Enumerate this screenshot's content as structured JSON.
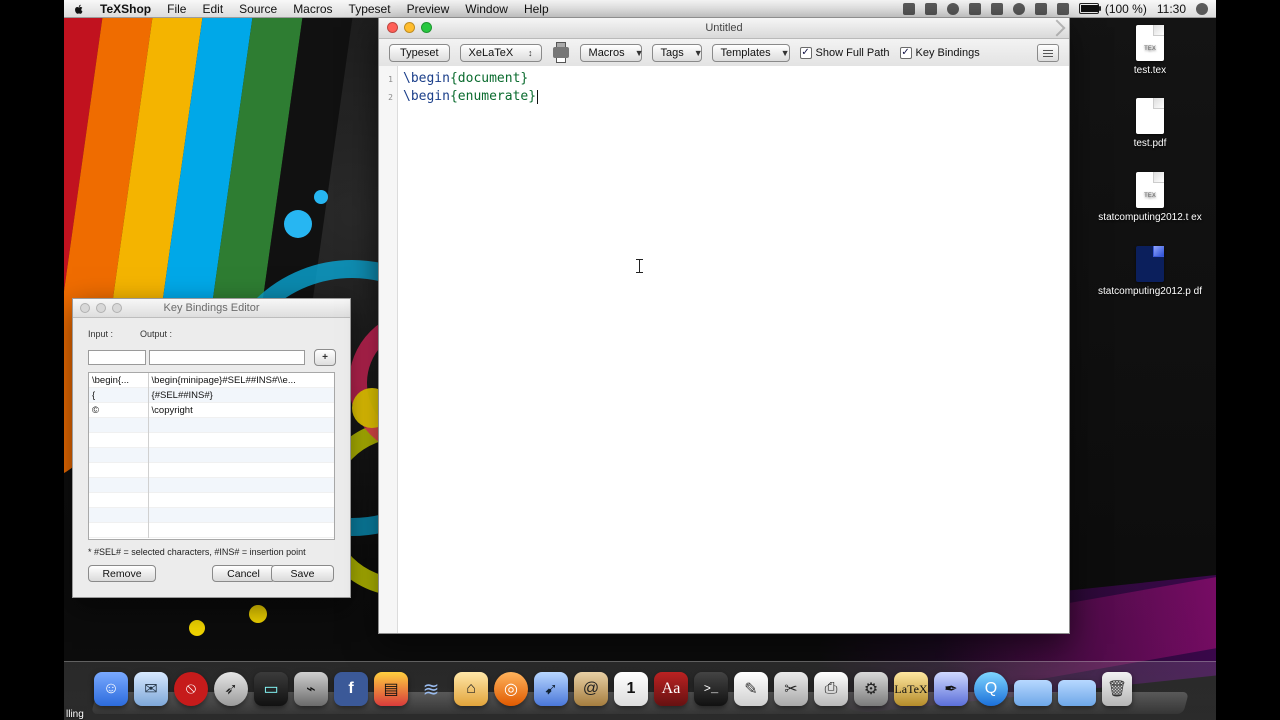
{
  "menubar": {
    "apple": "",
    "app_name": "TeXShop",
    "items": [
      "File",
      "Edit",
      "Source",
      "Macros",
      "Typeset",
      "Preview",
      "Window",
      "Help"
    ],
    "battery": "(100 %)",
    "clock": "11:30"
  },
  "texshop": {
    "window_title": "Untitled",
    "toolbar": {
      "typeset_button": "Typeset",
      "engine": "XeLaTeX",
      "macros": "Macros",
      "tags": "Tags",
      "templates": "Templates",
      "show_full_path": "Show Full Path",
      "key_bindings": "Key Bindings",
      "show_full_path_checked": true,
      "key_bindings_checked": true
    },
    "editor": {
      "line_numbers": [
        "1",
        "2"
      ],
      "lines": [
        {
          "cmd": "\\begin",
          "arg": "{document}"
        },
        {
          "cmd": "\\begin",
          "arg": "{enumerate}"
        }
      ]
    }
  },
  "key_bindings_editor": {
    "title": "Key Bindings Editor",
    "input_label": "Input :",
    "output_label": "Output :",
    "add_button": "+",
    "rows": [
      {
        "input": "\\begin{...",
        "output": "\\begin{minipage}#SEL##INS#\\\\e..."
      },
      {
        "input": "{",
        "output": "{#SEL##INS#}"
      },
      {
        "input": "©",
        "output": "\\copyright"
      },
      {
        "input": "",
        "output": ""
      },
      {
        "input": "",
        "output": ""
      },
      {
        "input": "",
        "output": ""
      },
      {
        "input": "",
        "output": ""
      },
      {
        "input": "",
        "output": ""
      },
      {
        "input": "",
        "output": ""
      },
      {
        "input": "",
        "output": ""
      },
      {
        "input": "",
        "output": ""
      }
    ],
    "hint": "* #SEL# = selected characters,  #INS# = insertion point",
    "buttons": {
      "remove": "Remove",
      "cancel": "Cancel",
      "save": "Save"
    }
  },
  "desktop_icons": [
    {
      "label": "test.tex"
    },
    {
      "label": "test.pdf"
    },
    {
      "label": "statcomputing2012.t ex"
    },
    {
      "label": "statcomputing2012.p df"
    }
  ],
  "dock": {
    "left_label": "lling",
    "icons": [
      "finder-icon",
      "mail-icon",
      "no-entry-icon",
      "rocket-icon",
      "monitor-icon",
      "network-icon",
      "facebook-icon",
      "tv-icon",
      "wifi-icon",
      "iphoto-icon",
      "firefox-icon",
      "bird-icon",
      "contacts-icon",
      "calendar-icon",
      "dictionary-icon",
      "terminal-icon",
      "pages-icon",
      "scissors-icon",
      "printer-icon",
      "system-preferences-icon",
      "latex-icon",
      "pen-icon",
      "quicktime-icon",
      "folder-icon",
      "folder-icon",
      "trash-icon"
    ],
    "calendar_day": "1",
    "dictionary_text": "Aa",
    "terminal_text": ">_",
    "latex_text": "LaTeX"
  }
}
